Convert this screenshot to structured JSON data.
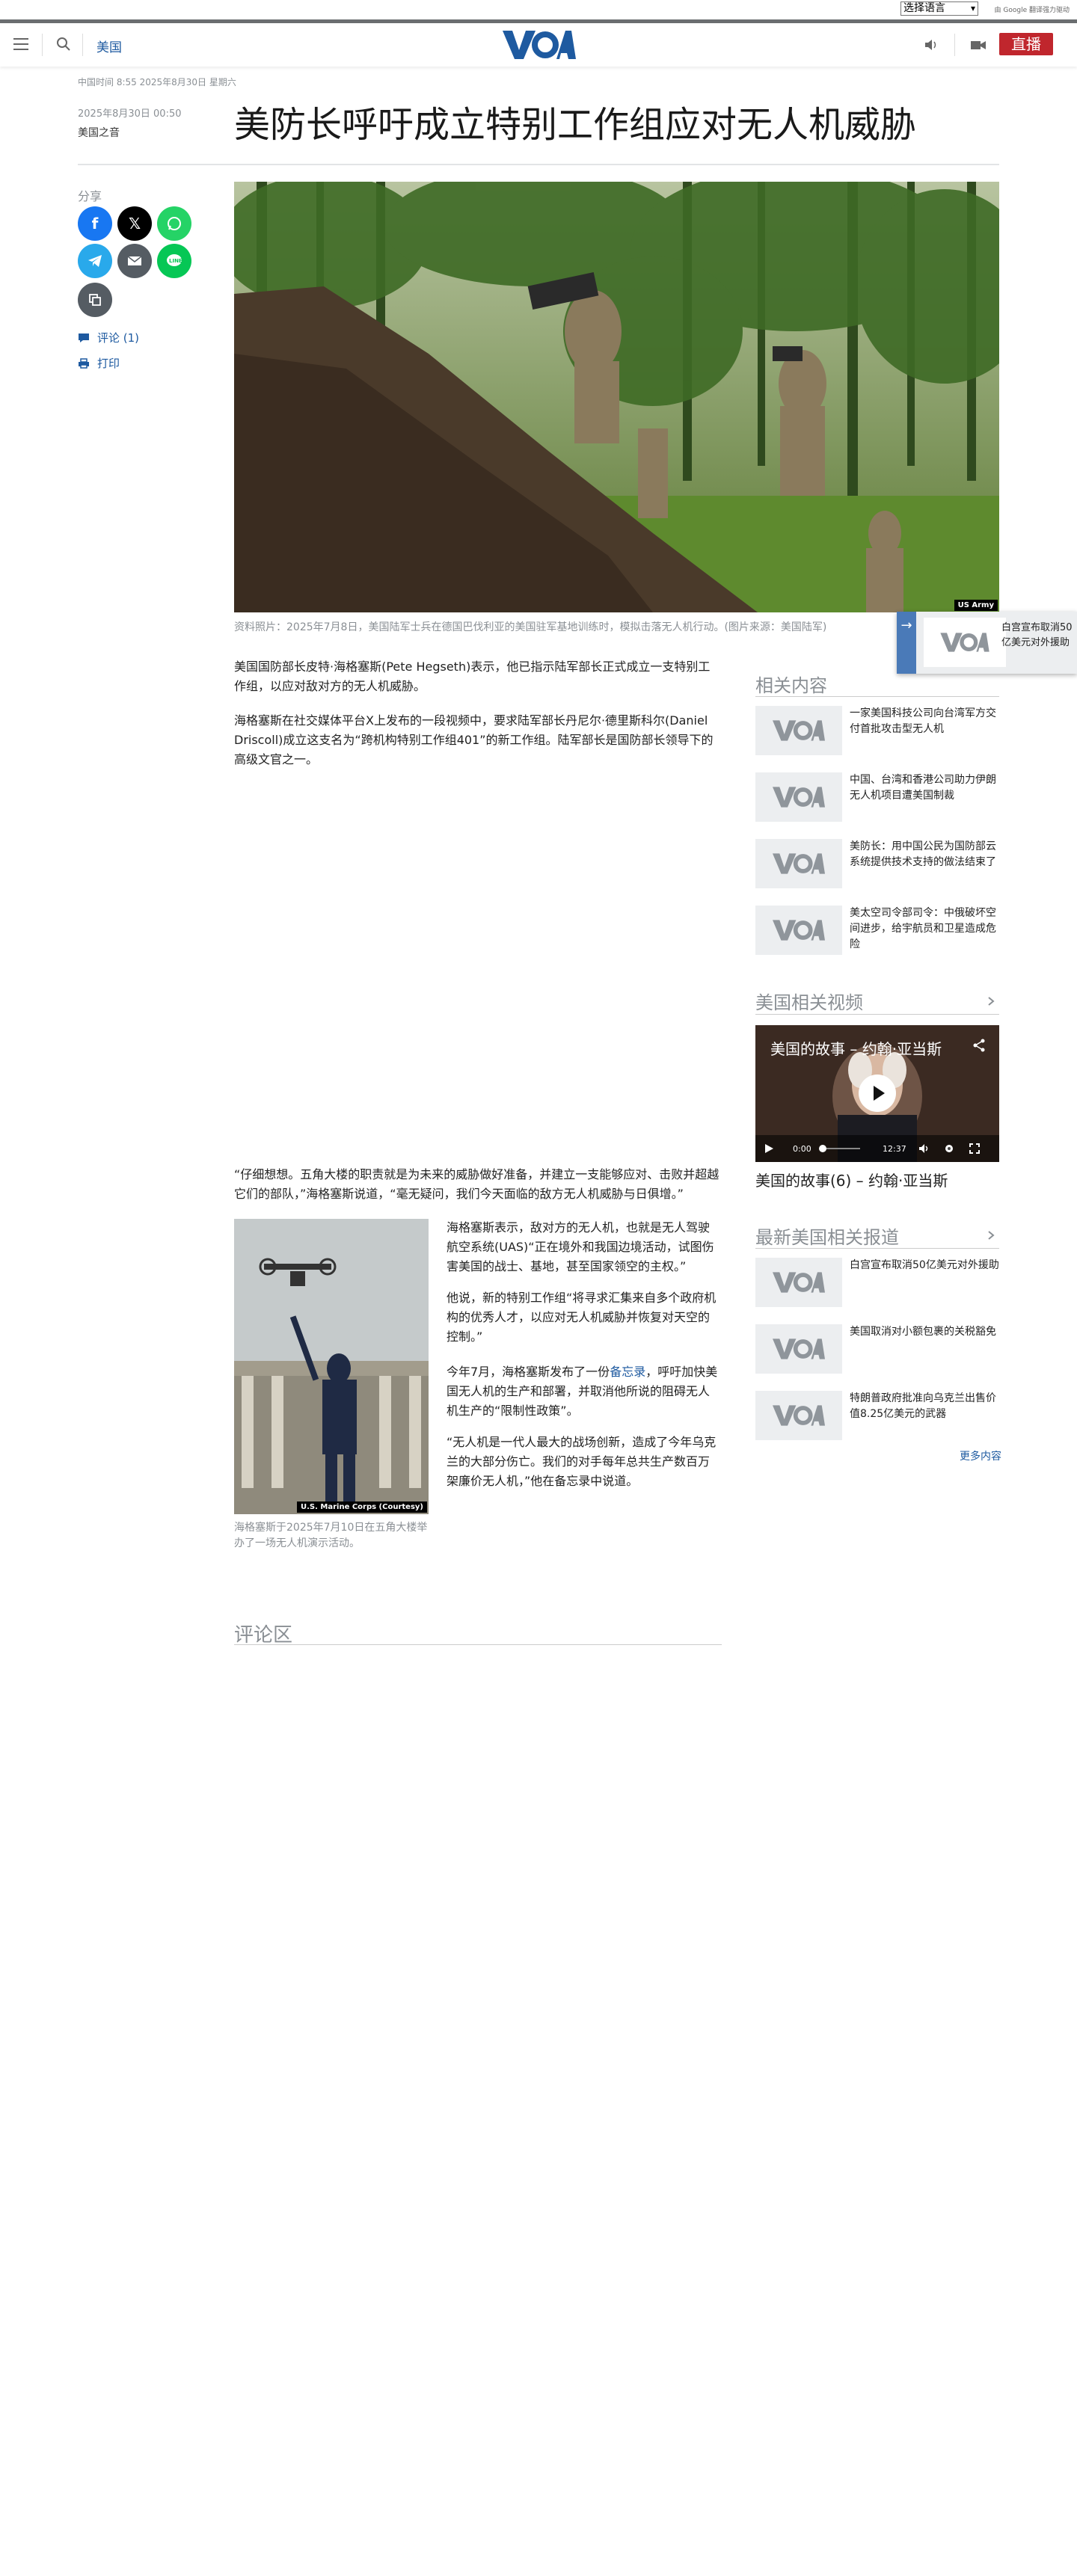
{
  "translate": {
    "select_label": "选择语言",
    "powered": "由 Google 翻译强力驱动"
  },
  "header": {
    "section": "美国",
    "live_label": "直播",
    "logo": "VOA"
  },
  "datetime": "中国时间 8:55 2025年8月30日 星期六",
  "article": {
    "pubdate": "2025年8月30日 00:50",
    "author": "美国之音",
    "title": "美防长呼吁成立特别工作组应对无人机威胁",
    "share_label": "分享",
    "comments_link": "评论 (1)",
    "print_link": "打印",
    "hero_credit": "US Army",
    "hero_caption": "资料照片：2025年7月8日，美国陆军士兵在德国巴伐利亚的美国驻军基地训练时，模拟击落无人机行动。(图片来源：美国陆军)",
    "p1": "美国国防部长皮特·海格塞斯(Pete Hegseth)表示，他已指示陆军部长正式成立一支特别工作组，以应对敌对方的无人机威胁。",
    "p2": "海格塞斯在社交媒体平台X上发布的一段视频中，要求陆军部长丹尼尔·德里斯科尔(Daniel Driscoll)成立这支名为“跨机构特别工作组401”的新工作组。陆军部长是国防部长领导下的高级文官之一。",
    "p3": "“仔细想想。五角大楼的职责就是为未来的威胁做好准备，并建立一支能够应对、击败并超越它们的部队，”海格塞斯说道，“毫无疑问，我们今天面临的敌方无人机威胁与日俱增。”",
    "inset_credit": "U.S. Marine Corps (Courtesy)",
    "inset_caption": "海格塞斯于2025年7月10日在五角大楼举办了一场无人机演示活动。",
    "p4": "海格塞斯表示，敌对方的无人机，也就是无人驾驶航空系统(UAS)“正在境外和我国边境活动，试图伤害美国的战士、基地，甚至国家领空的主权。”",
    "p5": "他说，新的特别工作组“将寻求汇集来自多个政府机构的优秀人才，以应对无人机威胁并恢复对天空的控制。”",
    "p6_before": "今年7月，海格塞斯发布了一份",
    "p6_link": "备忘录",
    "p6_after": "，呼吁加快美国无人机的生产和部署，并取消他所说的阻碍无人机生产的“限制性政策”。",
    "p7": "“无人机是一代人最大的战场创新，造成了今年乌克兰的大部分伤亡。我们的对手每年总共生产数百万架廉价无人机，”他在备忘录中说道。",
    "comments_title": "评论区"
  },
  "related": {
    "heading": "相关内容",
    "items": [
      {
        "title": "一家美国科技公司向台湾军方交付首批攻击型无人机"
      },
      {
        "title": "中国、台湾和香港公司助力伊朗无人机项目遭美国制裁"
      },
      {
        "title": "美防长：用中国公民为国防部云系统提供技术支持的做法结束了"
      },
      {
        "title": "美太空司令部司令：中俄破坏空间进步，给宇航员和卫星造成危险"
      }
    ]
  },
  "videos": {
    "heading": "美国相关视频",
    "video_title": "美国的故事 – 约翰·亚当斯",
    "time_current": "0:00",
    "time_total": "12:37",
    "caption": "美国的故事(6) – 约翰·亚当斯"
  },
  "latest": {
    "heading": "最新美国相关报道",
    "items": [
      {
        "title": "白宫宣布取消50亿美元对外援助"
      },
      {
        "title": "美国取消对小额包裹的关税豁免"
      },
      {
        "title": "特朗普政府批准向乌克兰出售价值8.25亿美元的武器"
      }
    ],
    "more": "更多内容"
  },
  "floating": {
    "title": "白宫宣布取消50亿美元对外援助"
  },
  "colors": {
    "accent": "#1e5aa0",
    "live": "#c0262d",
    "muted": "#8a8f94"
  }
}
